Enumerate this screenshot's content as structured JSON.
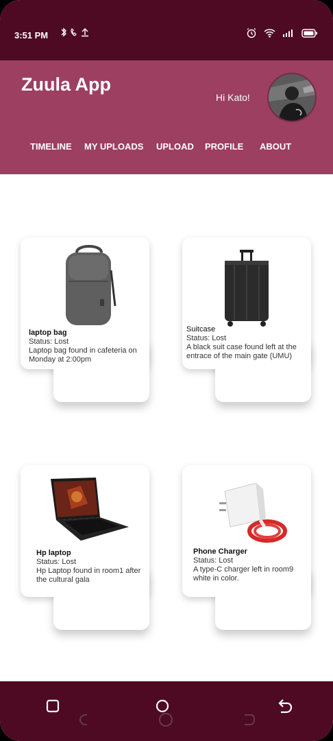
{
  "status_bar": {
    "time": "3:51 PM"
  },
  "header": {
    "app_title": "Zuula App",
    "greeting": "Hi Kato!",
    "nav": [
      "TIMELINE",
      "MY UPLOADS",
      "UPLOAD",
      "PROFILE",
      "ABOUT"
    ]
  },
  "items": [
    {
      "name": "laptop bag",
      "status": "Status: Lost",
      "desc": "Laptop bag found in cafeteria on Monday at 2:00pm"
    },
    {
      "name": "Suitcase",
      "status": "Status: Lost",
      "desc": "A black suit case found left at the entrace of the main gate (UMU)"
    },
    {
      "name": "Hp laptop",
      "status": "Status: Lost",
      "desc": "Hp Laptop found in room1 after the cultural gala"
    },
    {
      "name": "Phone Charger",
      "status": "Status: Lost",
      "desc": "A type-C charger left in room9 white in color."
    }
  ],
  "colors": {
    "dark_maroon": "#4e0a22",
    "header_maroon": "#9c3f60"
  }
}
